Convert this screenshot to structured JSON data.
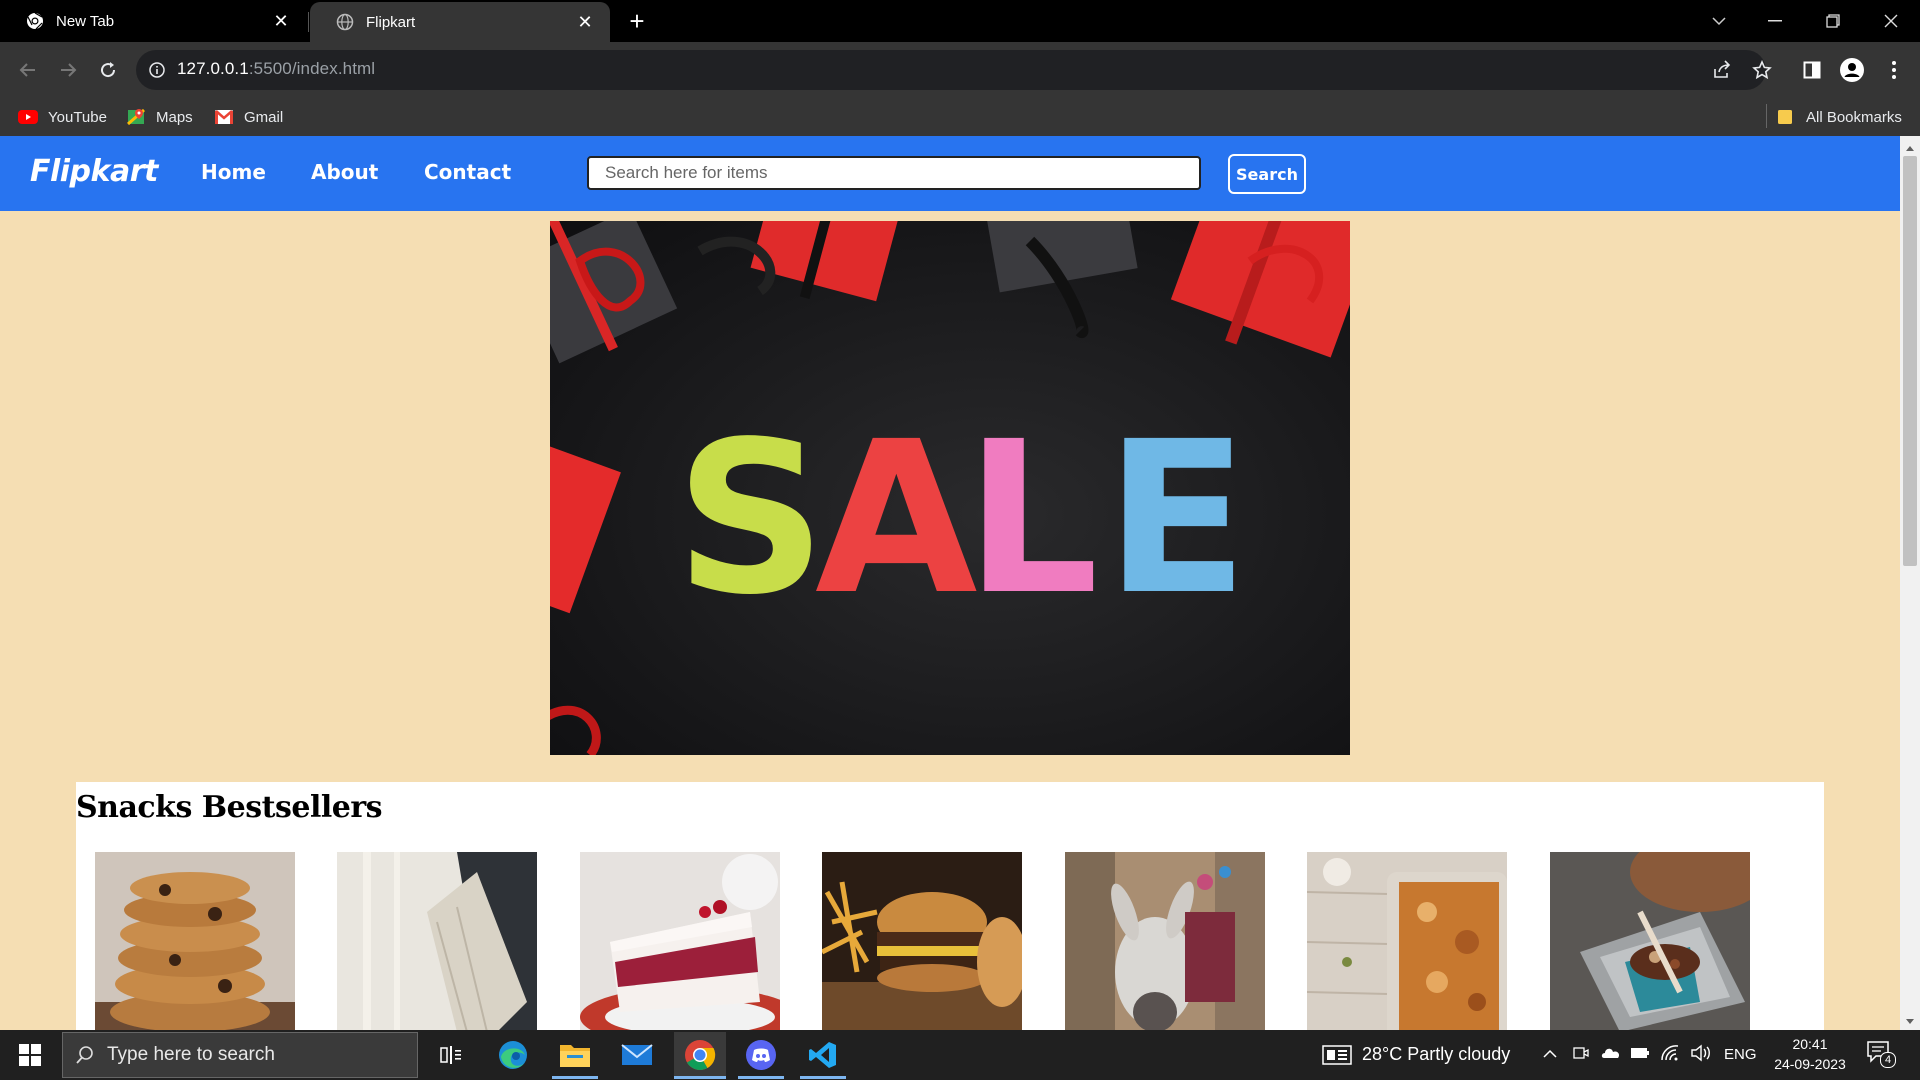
{
  "browser": {
    "tabs": [
      {
        "title": "New Tab",
        "icon": "chrome-icon",
        "active": false
      },
      {
        "title": "Flipkart",
        "icon": "globe-icon",
        "active": true
      }
    ],
    "url_host": "127.0.0.1",
    "url_path": ":5500/index.html",
    "bookmarks": [
      {
        "label": "YouTube",
        "icon": "youtube-icon"
      },
      {
        "label": "Maps",
        "icon": "maps-icon"
      },
      {
        "label": "Gmail",
        "icon": "gmail-icon"
      }
    ],
    "all_bookmarks": "All Bookmarks"
  },
  "page": {
    "logo": "Flipkart",
    "nav": {
      "home": "Home",
      "about": "About",
      "contact": "Contact"
    },
    "search": {
      "placeholder": "Search here for items",
      "button": "Search"
    },
    "banner_text": "SALE",
    "section_title": "Snacks Bestsellers",
    "products": [
      "cookies",
      "pasta",
      "cake",
      "burger",
      "donkey-street",
      "lasagna",
      "street-food"
    ]
  },
  "taskbar": {
    "search_placeholder": "Type here to search",
    "weather": "28°C  Partly cloudy",
    "language": "ENG",
    "time": "20:41",
    "date": "24-09-2023",
    "notification_count": "4"
  },
  "colors": {
    "navbar": "#2874f0",
    "page_bg": "#f5deb3"
  }
}
